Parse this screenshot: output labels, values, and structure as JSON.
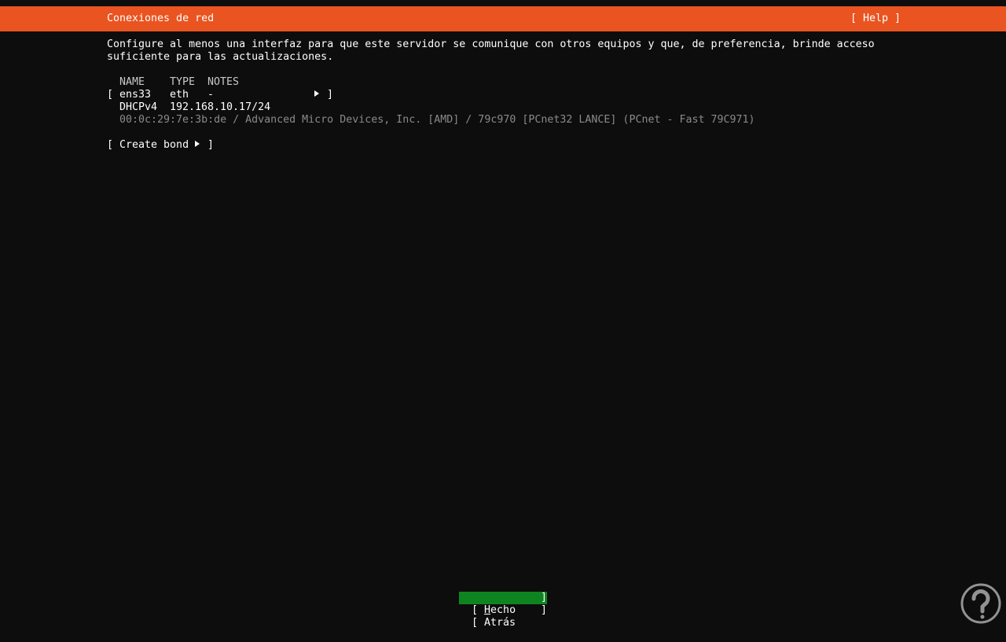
{
  "header": {
    "title": "Conexiones de red",
    "help": "[ Help ]"
  },
  "description": {
    "line1": "Configure al menos una interfaz para que este servidor se comunique con otros equipos y que, de preferencia, brinde acceso",
    "line2": "suficiente para las actualizaciones."
  },
  "table": {
    "columns": {
      "name": "NAME",
      "type": "TYPE",
      "notes": "NOTES"
    },
    "interface": {
      "open_bracket": "[",
      "name": "ens33",
      "type": "eth",
      "notes": "-",
      "close_bracket": "]",
      "address_method": "DHCPv4",
      "address": "192.168.10.17/24",
      "hardware": "00:0c:29:7e:3b:de / Advanced Micro Devices, Inc. [AMD] / 79c970 [PCnet32 LANCE] (PCnet - Fast 79C971)"
    }
  },
  "create_bond": {
    "open": "[ Create bond",
    "close": "]"
  },
  "buttons": {
    "done": {
      "open": "[ ",
      "hotkey": "H",
      "rest": "echo",
      "close": "]"
    },
    "back": {
      "label": "[ Atrás",
      "close": "]"
    }
  },
  "colors": {
    "header_bg": "#e95420",
    "background": "#0d0d0d",
    "primary_button_bg": "#0e8420",
    "dim_text": "#8a8a8a"
  },
  "icons": {
    "submenu": "triangle-right-icon",
    "watermark": "solvetic-logo-icon"
  }
}
